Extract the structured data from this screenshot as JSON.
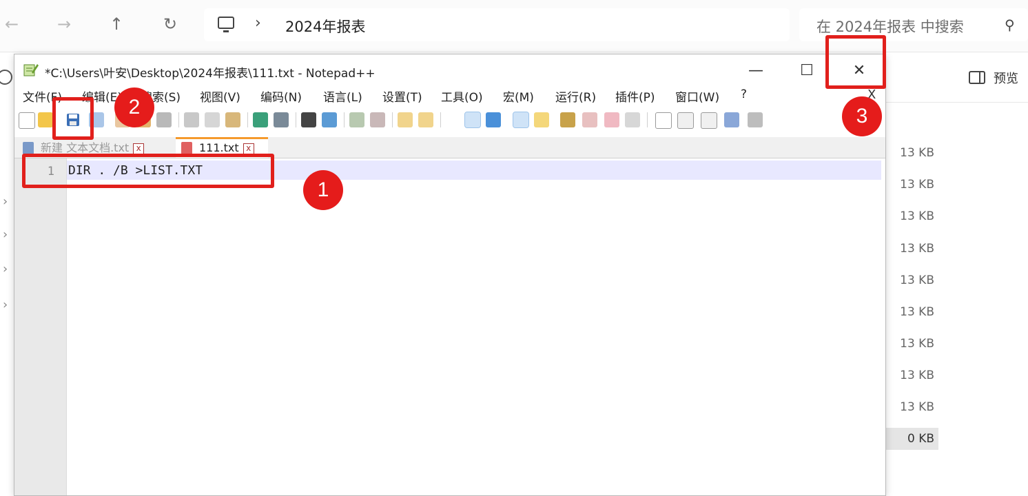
{
  "explorer": {
    "nav": {
      "back": "←",
      "forward": "→",
      "up": "↑",
      "refresh": "↻"
    },
    "breadcrumb_sep": "›",
    "path": "2024年报表",
    "search_placeholder": "在 2024年报表 中搜索",
    "preview_label": "预览",
    "sizes": [
      "13 KB",
      "13 KB",
      "13 KB",
      "13 KB",
      "13 KB",
      "13 KB",
      "13 KB",
      "13 KB",
      "13 KB",
      "0 KB"
    ]
  },
  "notepad": {
    "title": "*C:\\Users\\叶安\\Desktop\\2024年报表\\111.txt - Notepad++",
    "window_buttons": {
      "minimize": "—",
      "maximize": "☐",
      "close": "✕"
    },
    "menus": [
      "文件(F)",
      "编辑(E)",
      "搜索(S)",
      "视图(V)",
      "编码(N)",
      "语言(L)",
      "设置(T)",
      "工具(O)",
      "宏(M)",
      "运行(R)",
      "插件(P)",
      "窗口(W)",
      "?"
    ],
    "doc_close": "X",
    "tabs": [
      {
        "label": "新建 文本文档.txt",
        "active": false
      },
      {
        "label": "111.txt",
        "active": true
      }
    ],
    "tab_close": "x",
    "line_number": "1",
    "code": "DIR . /B >LIST.TXT"
  },
  "annotations": {
    "badge1": "1",
    "badge2": "2",
    "badge3": "3"
  },
  "colors": {
    "annotation_red": "#e1201c",
    "tab_active_accent": "#f59a2c",
    "current_line": "#e8e8ff"
  }
}
